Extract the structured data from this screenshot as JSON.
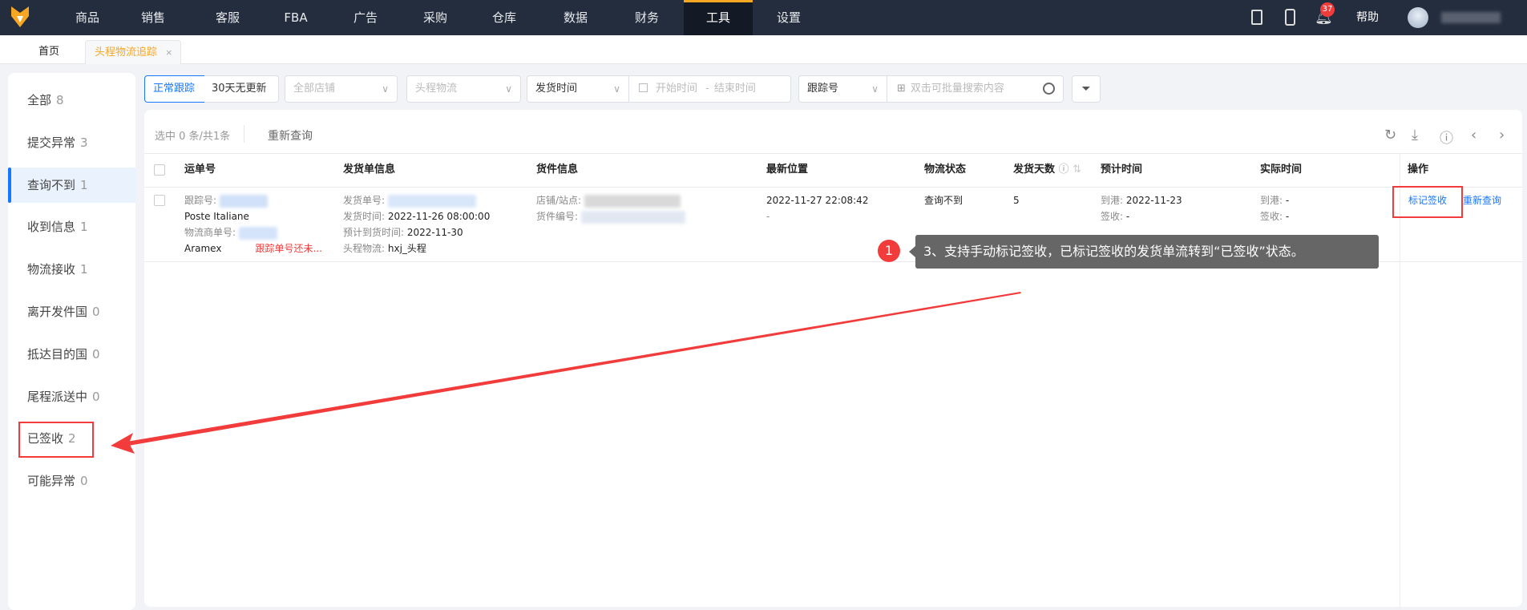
{
  "nav": {
    "items": [
      "商品",
      "销售",
      "客服",
      "FBA",
      "广告",
      "采购",
      "仓库",
      "数据",
      "财务",
      "工具",
      "设置"
    ],
    "active": "工具",
    "notification_count": "37",
    "help": "帮助"
  },
  "tabs": {
    "home": "首页",
    "current": "头程物流追踪",
    "close": "×"
  },
  "sidebar": {
    "items": [
      {
        "label": "全部",
        "count": "8"
      },
      {
        "label": "提交异常",
        "count": "3"
      },
      {
        "label": "查询不到",
        "count": "1"
      },
      {
        "label": "收到信息",
        "count": "1"
      },
      {
        "label": "物流接收",
        "count": "1"
      },
      {
        "label": "离开发件国",
        "count": "0"
      },
      {
        "label": "抵达目的国",
        "count": "0"
      },
      {
        "label": "尾程派送中",
        "count": "0"
      },
      {
        "label": "已签收",
        "count": "2"
      },
      {
        "label": "可能异常",
        "count": "0"
      }
    ],
    "active_index": 2
  },
  "filters": {
    "normal_tracking": "正常跟踪",
    "no_update_30": "30天无更新",
    "store_placeholder": "全部店铺",
    "logistics_placeholder": "头程物流",
    "time_type": "发货时间",
    "start_placeholder": "开始时间",
    "range_sep": "-",
    "end_placeholder": "结束时间",
    "search_type": "跟踪号",
    "search_placeholder": "双击可批量搜索内容"
  },
  "toolbar": {
    "selection": "选中 0 条/共1条",
    "requery": "重新查询"
  },
  "table": {
    "headers": [
      "运单号",
      "发货单信息",
      "货件信息",
      "最新位置",
      "物流状态",
      "发货天数",
      "预计时间",
      "实际时间",
      "操作"
    ],
    "row": {
      "tracking_label": "跟踪号:",
      "carrier": "Poste Italiane",
      "carrier_no_label": "物流商单号:",
      "carrier2": "Aramex",
      "tracking_warning": "跟踪单号还未...",
      "order_no_label": "发货单号:",
      "ship_time_label": "发货时间:",
      "ship_time": "2022-11-26 08:00:00",
      "eta_label": "预计到货时间:",
      "eta": "2022-11-30",
      "first_leg_label": "头程物流:",
      "first_leg": "hxj_头程",
      "store_label": "店铺/站点:",
      "shipment_label": "货件编号:",
      "latest_time": "2022-11-27 22:08:42",
      "latest_place": "-",
      "status": "查询不到",
      "days": "5",
      "est_port_label": "到港:",
      "est_port": "2022-11-23",
      "est_sign_label": "签收:",
      "est_sign": "-",
      "act_port_label": "到港:",
      "act_port": "-",
      "act_sign_label": "签收:",
      "act_sign": "-",
      "action_mark": "标记签收",
      "action_requery": "重新查询"
    }
  },
  "annotation": {
    "step": "1",
    "text": "3、支持手动标记签收，已标记签收的发货单流转到“已签收”状态。",
    "color": "#f23c3c"
  }
}
